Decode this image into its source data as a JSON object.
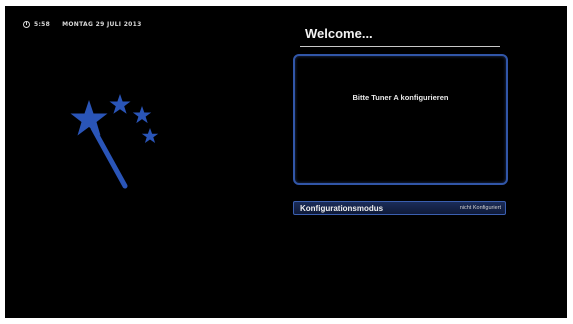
{
  "status_bar": {
    "clock_icon": "clock-icon",
    "time": "5:58",
    "date": "MONTAG 29 JULI 2013"
  },
  "wizard": {
    "icon": "magic-wand-icon",
    "title": "Welcome...",
    "message": "Bitte Tuner A konfigurieren"
  },
  "config_row": {
    "label": "Konfigurationsmodus",
    "value": "nicht Konfiguriert"
  },
  "colors": {
    "background": "#000000",
    "accent_blue": "#3156a8",
    "wand_blue": "#2a55b8",
    "text": "#f0f0f0"
  }
}
